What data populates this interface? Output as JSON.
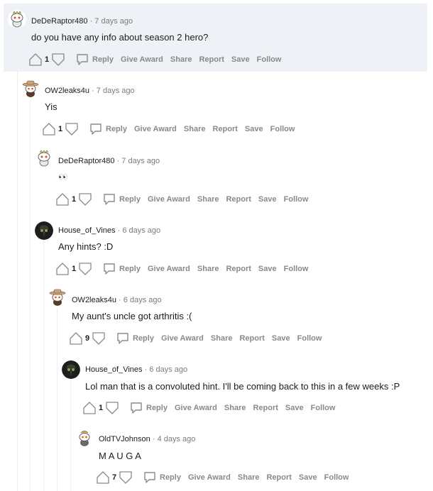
{
  "actions": {
    "reply": "Reply",
    "give_award": "Give Award",
    "share": "Share",
    "report": "Report",
    "save": "Save",
    "follow": "Follow"
  },
  "colors": {
    "highlight_bg": "#eef2f7",
    "meta_gray": "#7c7c7c",
    "action_gray": "#878a8c",
    "text": "#1c1c1c"
  },
  "comments": [
    {
      "username": "DeDeRaptor480",
      "sep": "·",
      "time": "7 days ago",
      "text": "do you have any info about season 2 hero?",
      "score": "1",
      "avatar_icon": "snoo-dino-avatar-icon"
    },
    {
      "username": "OW2leaks4u",
      "sep": "·",
      "time": "7 days ago",
      "text": "Yis",
      "score": "1",
      "avatar_icon": "snoo-cowboy-avatar-icon"
    },
    {
      "username": "DeDeRaptor480",
      "sep": "·",
      "time": "7 days ago",
      "text": "👀",
      "score": "1",
      "avatar_icon": "snoo-dino-avatar-icon"
    },
    {
      "username": "House_of_Vines",
      "sep": "·",
      "time": "6 days ago",
      "text": "Any hints? :D",
      "score": "1",
      "avatar_icon": "plague-doctor-avatar-icon"
    },
    {
      "username": "OW2leaks4u",
      "sep": "·",
      "time": "6 days ago",
      "text": "My aunt's uncle got arthritis :(",
      "score": "9",
      "avatar_icon": "snoo-cowboy-avatar-icon"
    },
    {
      "username": "House_of_Vines",
      "sep": "·",
      "time": "6 days ago",
      "text": "Lol man that is a convoluted hint. I'll be coming back to this in a few weeks :P",
      "score": "1",
      "avatar_icon": "plague-doctor-avatar-icon"
    },
    {
      "username": "OldTVJohnson",
      "sep": "·",
      "time": "4 days ago",
      "text": "M A U G A",
      "score": "7",
      "avatar_icon": "snoo-tv-avatar-icon"
    }
  ]
}
